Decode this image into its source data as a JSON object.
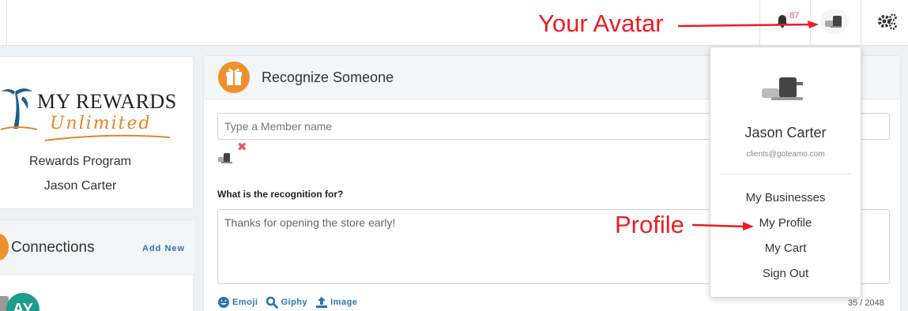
{
  "topbar": {
    "notification_count": "87"
  },
  "left_panel": {
    "logo_main": "MY REWARDS",
    "logo_sub": "Unlimited",
    "program_name": "Rewards Program",
    "user_name": "Jason Carter"
  },
  "connections": {
    "title": "Connections",
    "add_new": "Add New",
    "first_initials": "AY"
  },
  "recognize": {
    "title": "Recognize Someone",
    "member_placeholder": "Type a Member name",
    "remove_glyph": "✖",
    "question": "What is the recognition for?",
    "message": "Thanks for opening the store early!",
    "tools": [
      "Emoji",
      "Giphy",
      "Image"
    ],
    "counter": "35 / 2048"
  },
  "user_menu": {
    "name": "Jason Carter",
    "email": "clients@goteamo.com",
    "items": [
      "My Businesses",
      "My Profile",
      "My Cart",
      "Sign Out"
    ]
  },
  "annotations": {
    "avatar_label": "Your Avatar",
    "profile_label": "Profile",
    "color": "#ec1c24"
  },
  "colors": {
    "accent_orange": "#f0902d",
    "link_blue": "#2a74b3",
    "alert_pink": "#e4526a",
    "teal": "#1d9b8c"
  }
}
